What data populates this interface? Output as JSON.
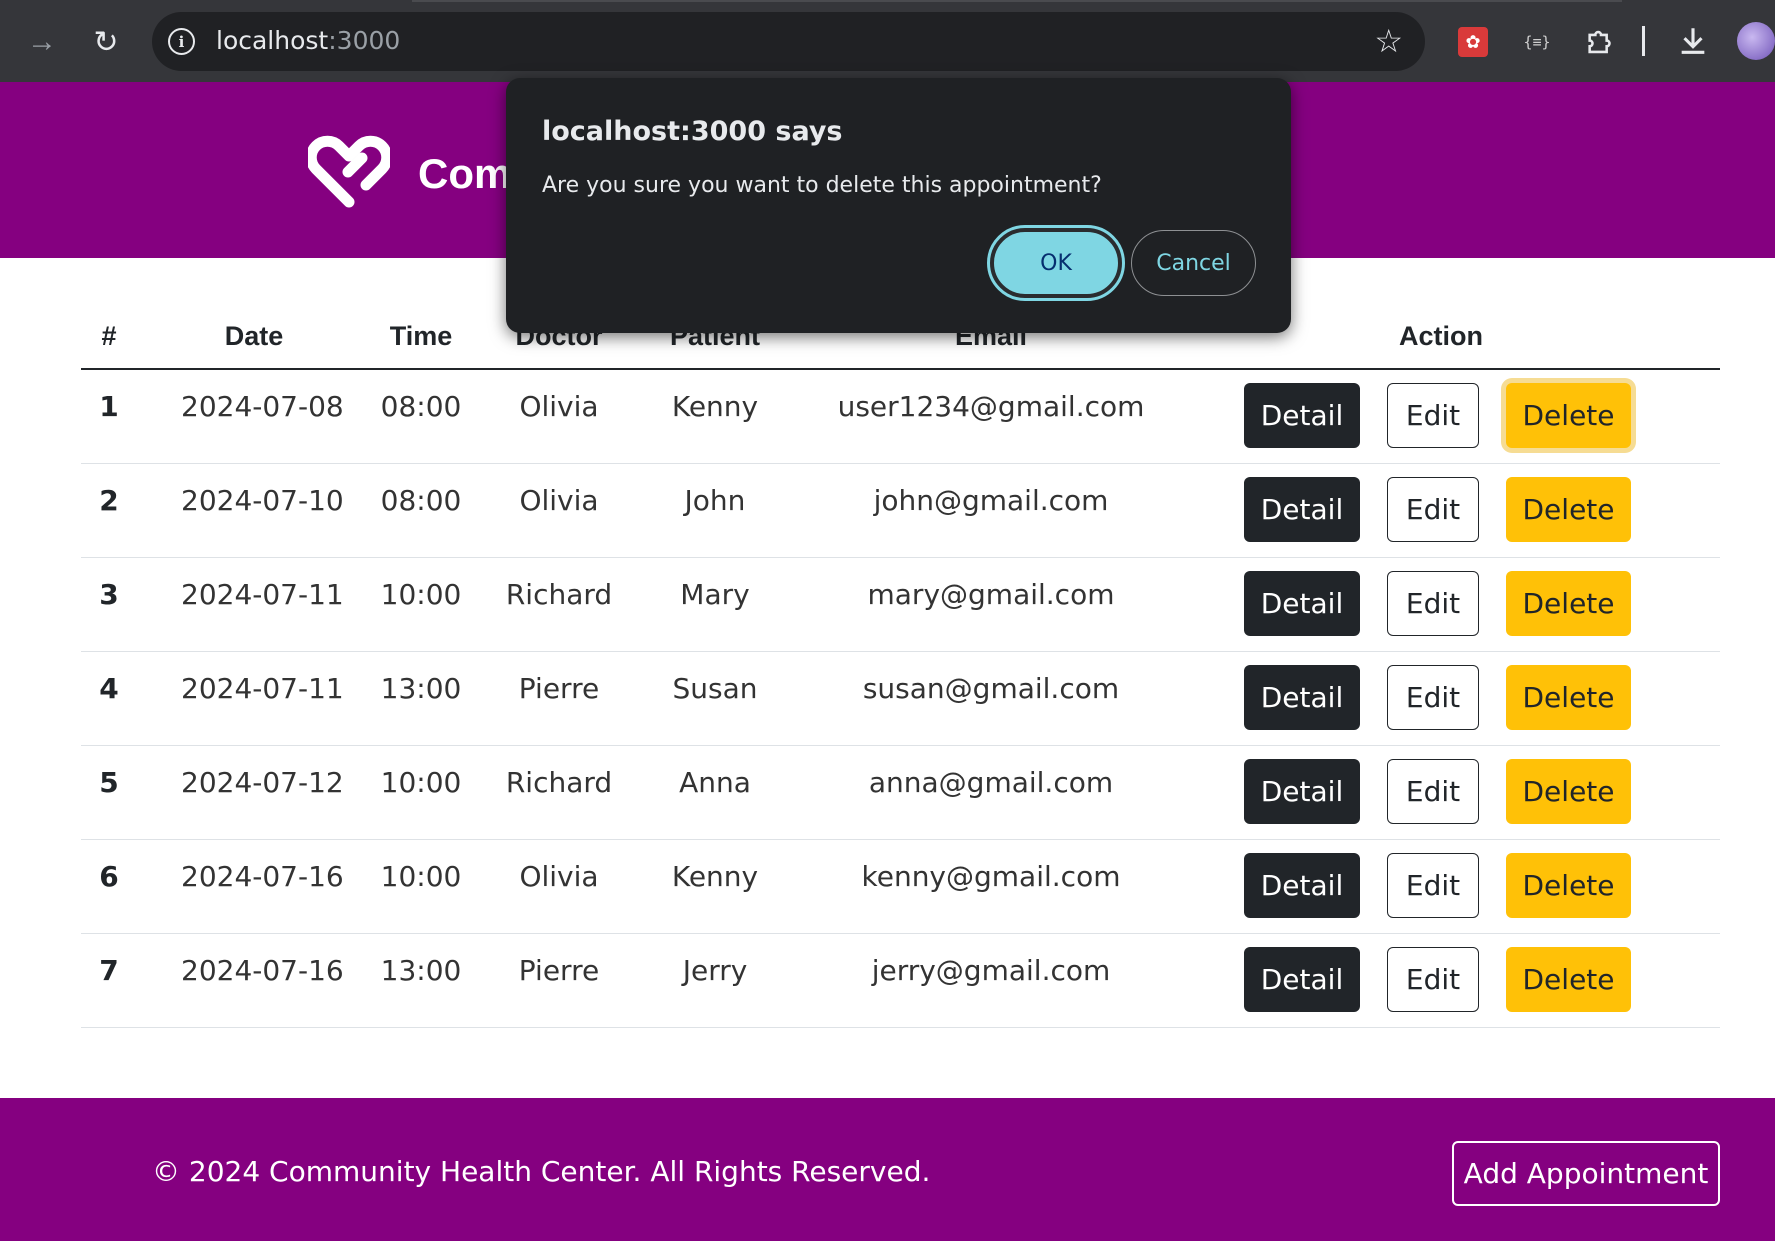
{
  "browser": {
    "url_host": "localhost",
    "url_port": ":3000",
    "icons": [
      "forward-icon",
      "reload-icon",
      "info-icon",
      "star-icon",
      "extension-icon",
      "json-extension-icon",
      "puzzle-icon",
      "download-icon",
      "profile-avatar"
    ]
  },
  "header": {
    "title": "Community Health Center Booking System"
  },
  "table": {
    "headers": [
      "#",
      "Date",
      "Time",
      "Doctor",
      "Patient",
      "Email",
      "Action"
    ],
    "rows": [
      {
        "num": "1",
        "date": "2024-07-08",
        "time": "08:00",
        "doctor": "Olivia",
        "patient": "Kenny",
        "email": "user1234@gmail.com"
      },
      {
        "num": "2",
        "date": "2024-07-10",
        "time": "08:00",
        "doctor": "Olivia",
        "patient": "John",
        "email": "john@gmail.com"
      },
      {
        "num": "3",
        "date": "2024-07-11",
        "time": "10:00",
        "doctor": "Richard",
        "patient": "Mary",
        "email": "mary@gmail.com"
      },
      {
        "num": "4",
        "date": "2024-07-11",
        "time": "13:00",
        "doctor": "Pierre",
        "patient": "Susan",
        "email": "susan@gmail.com"
      },
      {
        "num": "5",
        "date": "2024-07-12",
        "time": "10:00",
        "doctor": "Richard",
        "patient": "Anna",
        "email": "anna@gmail.com"
      },
      {
        "num": "6",
        "date": "2024-07-16",
        "time": "10:00",
        "doctor": "Olivia",
        "patient": "Kenny",
        "email": "kenny@gmail.com"
      },
      {
        "num": "7",
        "date": "2024-07-16",
        "time": "13:00",
        "doctor": "Pierre",
        "patient": "Jerry",
        "email": "jerry@gmail.com"
      }
    ],
    "actions": {
      "detail": "Detail",
      "edit": "Edit",
      "delete": "Delete"
    }
  },
  "footer": {
    "copyright": "© 2024 Community Health Center. All Rights Reserved.",
    "add_button": "Add Appointment"
  },
  "dialog": {
    "title": "localhost:3000 says",
    "message": "Are you sure you want to delete this appointment?",
    "ok": "OK",
    "cancel": "Cancel"
  },
  "colors": {
    "brand": "#850080",
    "delete": "#ffc107",
    "detail": "#212529",
    "dialog_bg": "#1f2124",
    "dialog_accent": "#7fd6e3"
  }
}
